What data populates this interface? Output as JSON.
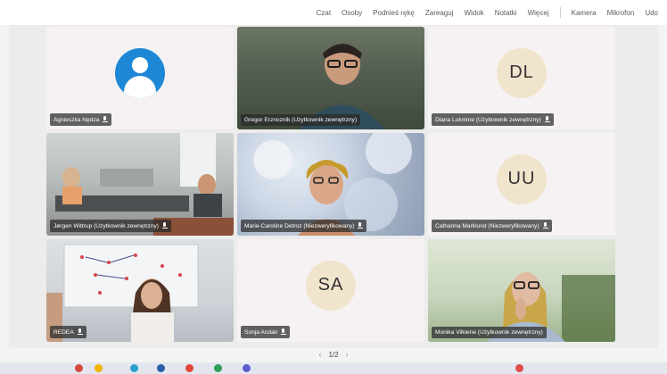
{
  "toolbar": {
    "items": [
      "Czat",
      "Osoby",
      "Podnieś rękę",
      "Zareaguj",
      "Widok",
      "Notatki",
      "Więcej"
    ],
    "devices": [
      "Kamera",
      "Mikrofon",
      "Udo"
    ]
  },
  "tiles": [
    {
      "name": "Agnieszka Nędza",
      "muted": true
    },
    {
      "name": "Gregor Erznoznik (Użytkownik zewnętrzny)",
      "muted": false,
      "active": true
    },
    {
      "name": "Diana Lukmine (Użytkownik zewnętrzny)",
      "muted": true,
      "initials": "DL"
    },
    {
      "name": "Jørgen Wittrup (Użytkownik zewnętrzny)",
      "muted": true
    },
    {
      "name": "Marie-Caroline Detroz (Niezweryfikowany)",
      "muted": true
    },
    {
      "name": "Catharina Marklund (Niezweryfikowany)",
      "muted": true,
      "initials": "UU"
    },
    {
      "name": "REDEA",
      "muted": true
    },
    {
      "name": "Sonja Andan",
      "muted": true,
      "initials": "SA"
    },
    {
      "name": "Monika Vilkiene (Użytkownik zewnętrzny)",
      "muted": false,
      "active": true
    }
  ],
  "pager": {
    "label": "1/2"
  },
  "colors": {
    "accent": "#6a67c9",
    "avatar_blue": "#1f88d6",
    "initials_bg": "#f1e4cc"
  }
}
